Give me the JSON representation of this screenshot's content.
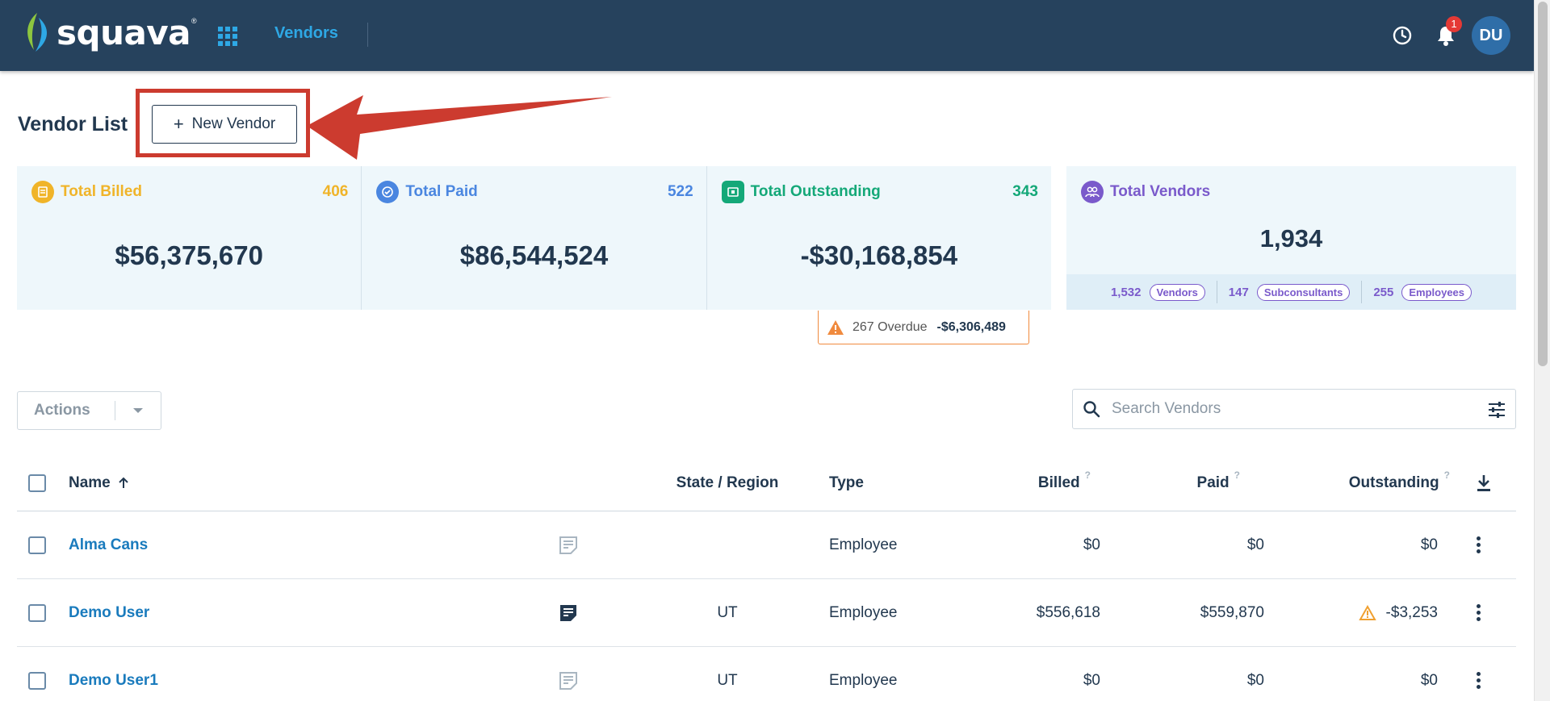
{
  "nav": {
    "brand": "squava",
    "registered": "®",
    "vendors_link": "Vendors",
    "notification_count": "1",
    "avatar_initials": "DU"
  },
  "page": {
    "title": "Vendor List",
    "new_vendor_label": "New Vendor"
  },
  "stats": {
    "billed": {
      "label": "Total Billed",
      "count": "406",
      "amount": "$56,375,670",
      "color": "#f0b429"
    },
    "paid": {
      "label": "Total Paid",
      "count": "522",
      "amount": "$86,544,524",
      "color": "#4a86e0"
    },
    "outstanding": {
      "label": "Total Outstanding",
      "count": "343",
      "amount": "-$30,168,854",
      "color": "#14a878"
    },
    "vendors": {
      "label": "Total Vendors",
      "total": "1,934",
      "color": "#7a5acb",
      "breakdown": [
        {
          "count": "1,532",
          "label": "Vendors"
        },
        {
          "count": "147",
          "label": "Subconsultants"
        },
        {
          "count": "255",
          "label": "Employees"
        }
      ]
    },
    "overdue": {
      "label": "267 Overdue",
      "amount": "-$6,306,489"
    }
  },
  "toolbar": {
    "actions_label": "Actions",
    "search_placeholder": "Search Vendors"
  },
  "table": {
    "headers": {
      "name": "Name",
      "state": "State / Region",
      "type": "Type",
      "billed": "Billed",
      "paid": "Paid",
      "outstanding": "Outstanding",
      "help": "?"
    },
    "rows": [
      {
        "name": "Alma Cans",
        "state": "",
        "type": "Employee",
        "billed": "$0",
        "paid": "$0",
        "outstanding": "$0",
        "note": "empty",
        "warning": false
      },
      {
        "name": "Demo User",
        "state": "UT",
        "type": "Employee",
        "billed": "$556,618",
        "paid": "$559,870",
        "outstanding": "-$3,253",
        "note": "filled",
        "warning": true
      },
      {
        "name": "Demo User1",
        "state": "UT",
        "type": "Employee",
        "billed": "$0",
        "paid": "$0",
        "outstanding": "$0",
        "note": "empty",
        "warning": false
      }
    ]
  }
}
